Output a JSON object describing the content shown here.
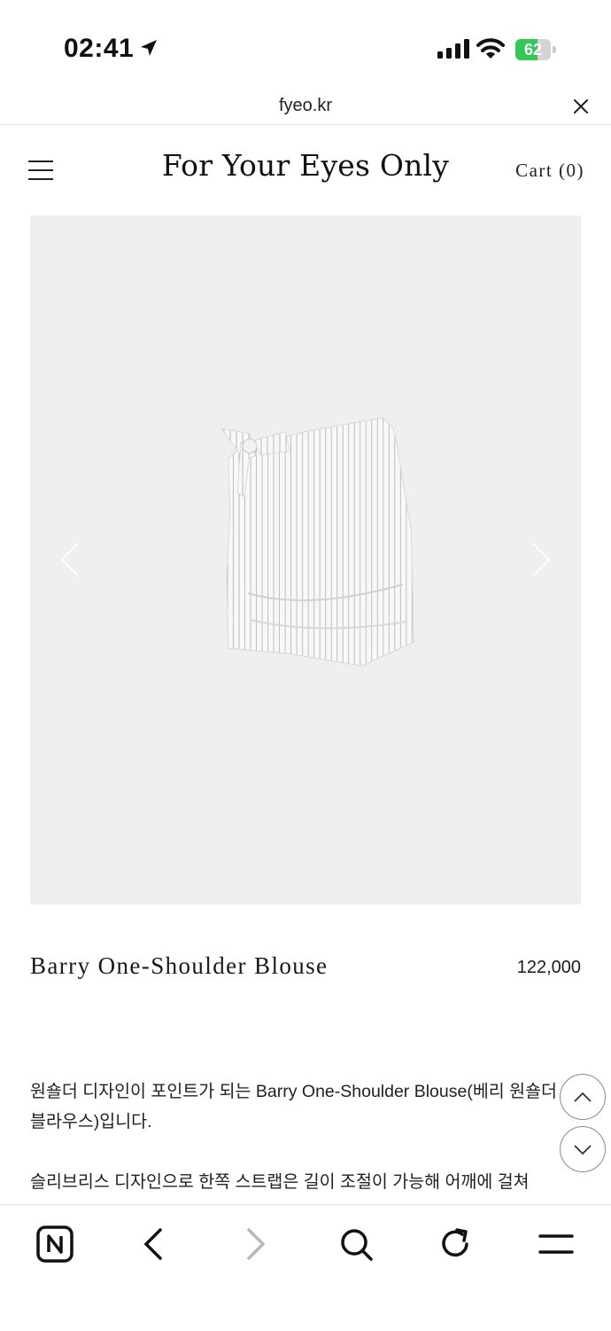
{
  "status_bar": {
    "time": "02:41",
    "battery_level": "62",
    "icons": [
      "location-arrow-icon",
      "cellular-signal-icon",
      "wifi-icon",
      "battery-charging-icon"
    ]
  },
  "browser": {
    "url": "fyeo.kr",
    "toolbar_icons": [
      "naver-home-icon",
      "back-icon",
      "forward-icon",
      "search-icon",
      "refresh-icon",
      "menu-icon"
    ]
  },
  "header": {
    "brand": "For Your Eyes Only",
    "cart_label": "Cart (0)"
  },
  "product": {
    "title": "Barry One-Shoulder Blouse",
    "price": "122,000",
    "description_1": "원숄더 디자인이 포인트가 되는 Barry One-Shoulder Blouse(베리 원숄더 블라우스)입니다.",
    "description_2": "슬리브리스 디자인으로 한쪽 스트랩은 길이 조절이 가능해 어깨에 걸쳐"
  },
  "colors": {
    "image_background": "#efefef",
    "battery_green": "#34c759",
    "text": "#111111"
  }
}
